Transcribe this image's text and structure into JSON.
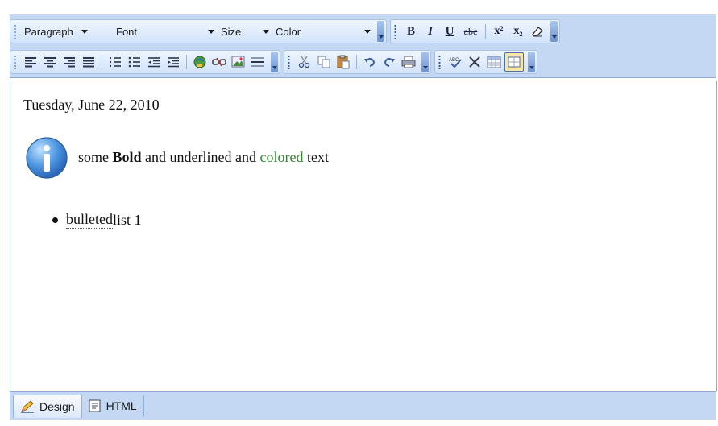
{
  "toolbar": {
    "paragraph_label": "Paragraph",
    "font_label": "Font",
    "size_label": "Size",
    "color_label": "Color",
    "bold_label": "B",
    "italic_label": "I",
    "underline_label": "U",
    "strike_label": "abc",
    "superscript_label": "x²",
    "subscript_label": "x₂"
  },
  "content": {
    "date": "Tuesday, June 22, 2010",
    "para_part1": "some ",
    "para_bold": "Bold",
    "para_part2": " and ",
    "para_underlined": "underlined",
    "para_part3": " and ",
    "para_colored": "colored",
    "para_part4": " text",
    "list_word_spell": "bulleted",
    "list_rest": " list 1"
  },
  "tabs": {
    "design_label": "Design",
    "html_label": "HTML"
  },
  "colors": {
    "toolbar_bg": "#c4d8f4",
    "colored_text": "#2e8a2e"
  }
}
